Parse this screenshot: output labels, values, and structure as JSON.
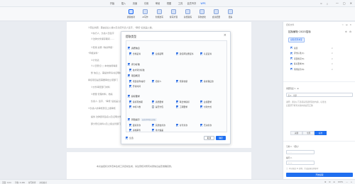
{
  "titlebar": {
    "menu": [
      "开始",
      "插入",
      "页面",
      "引用",
      "审阅",
      "视图",
      "工具",
      "会员专享",
      "WPS"
    ],
    "active_index": 8,
    "right_items": [
      "⊙",
      "△"
    ],
    "window_controls": [
      "—",
      "▢",
      "✕"
    ]
  },
  "ribbon": {
    "tools": [
      {
        "label": "通篇校对",
        "active": true
      },
      {
        "label": "AI写作"
      },
      {
        "label": "智能改写"
      },
      {
        "label": "续写扩展"
      },
      {
        "label": "总结提炼"
      },
      {
        "label": "润色优化"
      },
      {
        "label": "会议纪要"
      },
      {
        "label": "更多"
      }
    ]
  },
  "document": {
    "lines": [
      "②营业执照：需由企业公章以及法定代表人签字，“审核”后加盖公章。",
      "③执行人、负责人员签字",
      "④法律文件保存期间……",
      "①费用 资质 “物资申报”",
      "“申报资料”",
      "②计划表",
      "③人员登记 □ 本地信用等级",
      "整  信息上，需提供申请书证明材料",
      "承接项目是否需要审批立项部门",
      "①文件审查部门材料",
      "②质量 管理材料、档案",
      "负责人: 签字、“审核”后加盖公章与",
      "④负责人的审核意见上报审核",
      "提供 法律顾问签名以及证明文件",
      "部分登记资料以及上级主管部门审批"
    ],
    "footer_line": "本文由招标文件范本生成工具自动生成，请注意核对所有关键信息是否准确完整。"
  },
  "dialog": {
    "title": "提取类型",
    "close": "×",
    "groups": [
      {
        "name": "资质信息",
        "checked": true,
        "chip": "",
        "options": [
          {
            "label": "合格证书",
            "checked": true
          },
          {
            "label": "业绩证明",
            "checked": true
          },
          {
            "label": "建造师注册证书",
            "checked": true
          },
          {
            "label": "认证证书",
            "checked": true
          }
        ]
      },
      {
        "name": "评分标准",
        "checked": true,
        "chip": "",
        "options": [
          {
            "label": "技术评分标准",
            "checked": true
          }
        ]
      },
      {
        "name": "项目概况",
        "checked": true,
        "chip": "",
        "options": [
          {
            "label": "项目名称/编号",
            "checked": true
          },
          {
            "label": "招标人",
            "checked": true
          },
          {
            "label": "预算金额",
            "checked": true
          },
          {
            "label": "投标保证金",
            "checked": true
          },
          {
            "label": "开标时间",
            "checked": true
          }
        ]
      },
      {
        "name": "投标要求",
        "checked": true,
        "chip": "",
        "options": [
          {
            "label": "投标有效期",
            "checked": true
          },
          {
            "label": "资质要求",
            "checked": true
          },
          {
            "label": "联合体投标",
            "checked": true
          },
          {
            "label": "业绩要求",
            "checked": true
          },
          {
            "label": "中标人数",
            "checked": true
          },
          {
            "label": "是否分包",
            "checked": false
          },
          {
            "label": "工期要求",
            "checked": true
          },
          {
            "label": "付款方式",
            "checked": true
          }
        ]
      },
      {
        "name": "风险提示",
        "checked": true,
        "chip": "该类型将默认提取",
        "options": [
          {
            "label": "废标条款",
            "checked": true
          },
          {
            "label": "实质性条款",
            "checked": true
          },
          {
            "label": "星号条款",
            "checked": true
          },
          {
            "label": "否决条款",
            "checked": true
          },
          {
            "label": "资格审查",
            "checked": true
          },
          {
            "label": "重大偏差",
            "checked": true
          }
        ]
      }
    ],
    "footer_option": "全选",
    "cancel": "取消",
    "ok": "确定"
  },
  "right_panel": {
    "header_label": "招标文件",
    "header_icons": "☆ ⊟ ✕",
    "title": "招标解析·2025招标",
    "title_icons": "⊕ ⚙",
    "tag": "提取结果类型",
    "list": [
      {
        "label": "资质",
        "count": ""
      },
      {
        "label": "评分标准(1)",
        "count": ""
      },
      {
        "label": "项目概况(5)",
        "count": ""
      },
      {
        "label": "投标要求(8)",
        "count": ""
      },
      {
        "label": "风险提示(6)",
        "count": ""
      }
    ],
    "section1_label": "重要程度 ▾  ·  ⊕",
    "input1": "高  ▾  ·  全部",
    "note1": "说明：通过以下选项来筛选所需的内容，标准化",
    "note1b": "后更便于检查文档内容是否正确",
    "seg": [
      "关键",
      "全部",
      "标准"
    ],
    "seg_on": 2,
    "section2_label": "引用 ▾  ·  “招标”",
    "input2": "· · · ·",
    "section3_label": "编号 ▾  ·",
    "input3": "— —",
    "footer_note": "本功能由 AI 提供，生成结果仅供参考",
    "action_button": "开始提取"
  },
  "statusbar": {
    "left": [
      "页面: 3/14",
      "字数: 3,456",
      "拼写检查",
      "文档校对"
    ],
    "right": [
      "⊞",
      "⊟",
      "☰",
      "100%",
      "—",
      "+"
    ]
  }
}
